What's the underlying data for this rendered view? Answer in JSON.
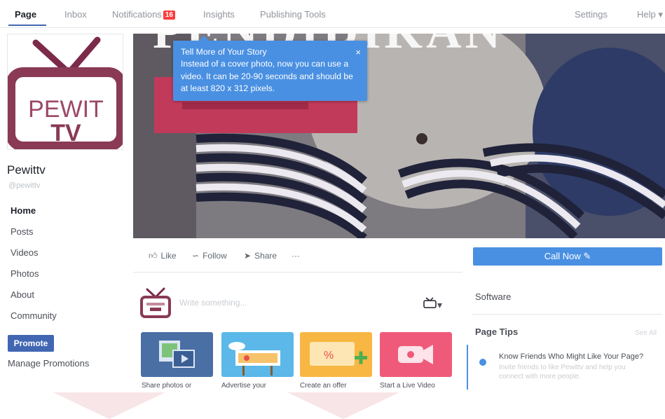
{
  "nav": {
    "tabs": [
      {
        "label": "Page"
      },
      {
        "label": "Inbox"
      },
      {
        "label": "Notifications",
        "badge": "16"
      },
      {
        "label": "Insights"
      },
      {
        "label": "Publishing Tools"
      }
    ],
    "settings_label": "Settings",
    "help_label": "Help ▾"
  },
  "profile": {
    "logo_text_top": "PEWIT",
    "logo_text_bottom": "TV",
    "name": "Pewittv",
    "handle": "@pewittv",
    "colors": {
      "brand": "#8a3a55",
      "brand_light": "#c48aa0"
    }
  },
  "sidebar": {
    "items": [
      {
        "label": "Home"
      },
      {
        "label": "Posts"
      },
      {
        "label": "Videos"
      },
      {
        "label": "Photos"
      },
      {
        "label": "About"
      },
      {
        "label": "Community"
      }
    ],
    "promote_label": "Promote",
    "manage_label": "Manage Promotions"
  },
  "cover": {
    "title": "PENDIDIKAN",
    "tooltip": {
      "title": "Tell More of Your Story",
      "body": "Instead of a cover photo, now you can use a video. It can be 20-90 seconds and should be at least 820 x 312 pixels.",
      "close": "×"
    }
  },
  "actions": {
    "like": "Like",
    "follow": "Follow",
    "share": "Share",
    "more": "···",
    "call_now": "Call Now ✎"
  },
  "composer": {
    "placeholder": "Write something...",
    "page_switch": "▾"
  },
  "cards": [
    {
      "label": "Share photos or",
      "color": "#4a6fa5"
    },
    {
      "label": "Advertise your",
      "color": "#5bb8e8"
    },
    {
      "label": "Create an offer",
      "color": "#f7b742"
    },
    {
      "label": "Start a Live Video",
      "color": "#f05a7a"
    }
  ],
  "right": {
    "category": "Software",
    "tips_title": "Page Tips",
    "see_all": "See All",
    "tip_title": "Know Friends Who Might Like Your Page?",
    "tip_body": "Invite friends to like Pewittv and help you connect with more people."
  },
  "colors": {
    "accent": "#4267b2",
    "tooltip": "#4a90e2"
  }
}
